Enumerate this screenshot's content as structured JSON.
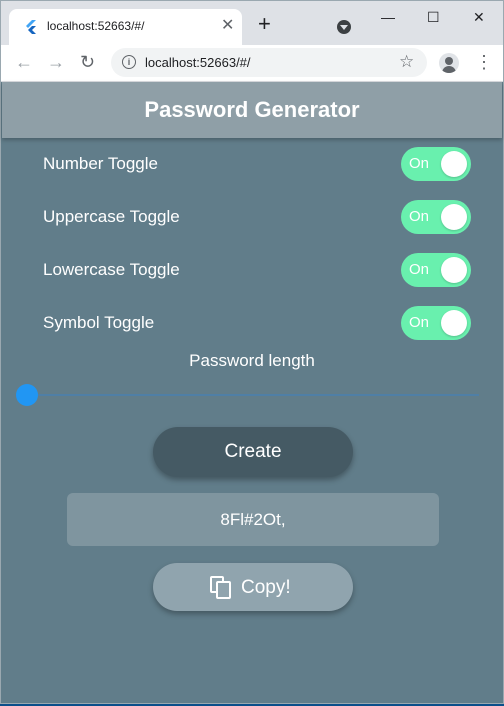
{
  "browser": {
    "tab_title": "localhost:52663/#/",
    "tab_close": "✕",
    "new_tab": "+",
    "url": "localhost:52663/#/",
    "controls": {
      "minimize": "—",
      "maximize": "☐",
      "close": "✕"
    }
  },
  "app": {
    "title": "Password Generator",
    "toggles": [
      {
        "label": "Number Toggle",
        "state": "On"
      },
      {
        "label": "Uppercase Toggle",
        "state": "On"
      },
      {
        "label": "Lowercase Toggle",
        "state": "On"
      },
      {
        "label": "Symbol Toggle",
        "state": "On"
      }
    ],
    "length_label": "Password length",
    "slider_value_fraction": 0.0,
    "create_label": "Create",
    "password": "8Fl#2Ot,",
    "copy_label": "Copy!"
  },
  "colors": {
    "switch_on": "#69f0ae",
    "slider": "#2196f3",
    "background": "#617d8a",
    "appbar": "#8f9fa7",
    "create_button": "#455a64",
    "copy_button": "#90a4ae"
  },
  "icons": [
    "flutter-favicon-icon",
    "tab-search-icon",
    "back-icon",
    "forward-icon",
    "reload-icon",
    "info-icon",
    "star-icon",
    "profile-icon",
    "menu-icon",
    "copy-icon"
  ]
}
